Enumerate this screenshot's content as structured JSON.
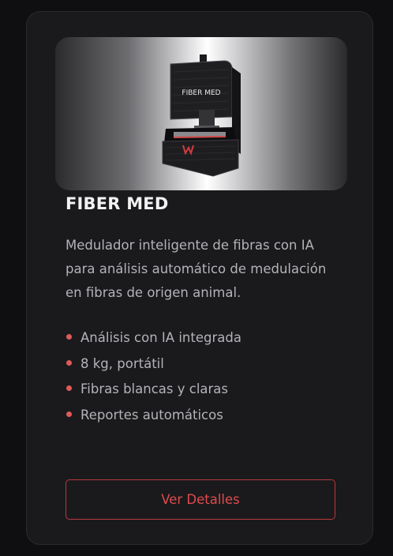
{
  "product": {
    "image_label": "FIBER MED",
    "title": "FIBER MED",
    "description": "Medulador inteligente de fibras con IA para análisis automático de medulación en fibras de origen animal.",
    "features": [
      "Análisis con IA integrada",
      "8 kg, portátil",
      "Fibras blancas y claras",
      "Reportes automáticos"
    ],
    "cta_label": "Ver Detalles"
  },
  "colors": {
    "accent": "#e04b4d",
    "card_bg": "#1a1a1d",
    "page_bg": "#0f0f11"
  }
}
